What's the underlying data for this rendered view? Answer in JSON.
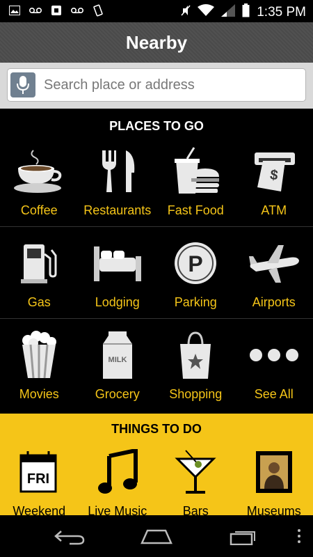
{
  "status_bar": {
    "time": "1:35 PM"
  },
  "header": {
    "title": "Nearby"
  },
  "search": {
    "placeholder": "Search place or address"
  },
  "places": {
    "title": "PLACES TO GO",
    "items": [
      {
        "label": "Coffee"
      },
      {
        "label": "Restaurants"
      },
      {
        "label": "Fast Food"
      },
      {
        "label": "ATM"
      },
      {
        "label": "Gas"
      },
      {
        "label": "Lodging"
      },
      {
        "label": "Parking"
      },
      {
        "label": "Airports"
      },
      {
        "label": "Movies"
      },
      {
        "label": "Grocery"
      },
      {
        "label": "Shopping"
      },
      {
        "label": "See All"
      }
    ]
  },
  "things": {
    "title": "THINGS TO DO",
    "items": [
      {
        "label": "Weekend",
        "icon_text": "FRI"
      },
      {
        "label": "Live Music"
      },
      {
        "label": "Bars"
      },
      {
        "label": "Museums"
      }
    ]
  },
  "icons": {
    "parking_letter": "P",
    "milk_text": "MILK",
    "atm_symbol": "$"
  },
  "colors": {
    "accent": "#f5c518",
    "background": "#000000",
    "header": "#4a4a4a"
  }
}
